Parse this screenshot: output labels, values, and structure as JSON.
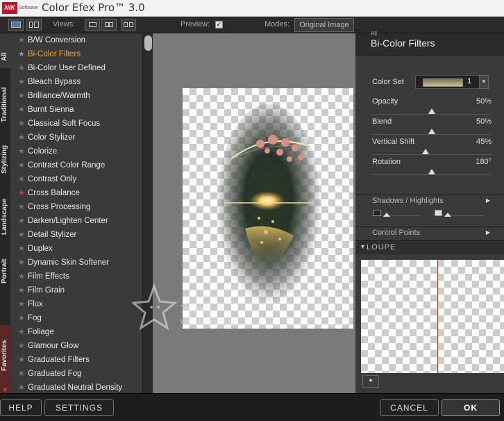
{
  "titlebar": {
    "title": "Color Efex Pro™ 3.0",
    "logo_text": "NIK",
    "logo_sub": "Software"
  },
  "toolbar": {
    "views_label": "Views:",
    "preview_label": "Preview:",
    "preview_checked": true,
    "modes_label": "Modes:",
    "original_image_label": "Original Image"
  },
  "vtabs": [
    "All",
    "Traditional",
    "Stylizing",
    "Landscape",
    "Portrait",
    "Favorites"
  ],
  "filters": [
    {
      "label": "B/W Conversion",
      "active": false,
      "fav": false
    },
    {
      "label": "Bi-Color Filters",
      "active": true,
      "fav": false
    },
    {
      "label": "Bi-Color User Defined",
      "active": false,
      "fav": false
    },
    {
      "label": "Bleach Bypass",
      "active": false,
      "fav": false
    },
    {
      "label": "Brilliance/Warmth",
      "active": false,
      "fav": false
    },
    {
      "label": "Burnt Sienna",
      "active": false,
      "fav": false
    },
    {
      "label": "Classical Soft Focus",
      "active": false,
      "fav": false
    },
    {
      "label": "Color Stylizer",
      "active": false,
      "fav": false
    },
    {
      "label": "Colorize",
      "active": false,
      "fav": false
    },
    {
      "label": "Contrast Color Range",
      "active": false,
      "fav": false
    },
    {
      "label": "Contrast Only",
      "active": false,
      "fav": false
    },
    {
      "label": "Cross Balance",
      "active": false,
      "fav": true
    },
    {
      "label": "Cross Processing",
      "active": false,
      "fav": false
    },
    {
      "label": "Darken/Lighten Center",
      "active": false,
      "fav": false
    },
    {
      "label": "Detail Stylizer",
      "active": false,
      "fav": false
    },
    {
      "label": "Duplex",
      "active": false,
      "fav": false
    },
    {
      "label": "Dynamic Skin Softener",
      "active": false,
      "fav": false
    },
    {
      "label": "Film Effects",
      "active": false,
      "fav": false
    },
    {
      "label": "Film Grain",
      "active": false,
      "fav": false
    },
    {
      "label": "Flux",
      "active": false,
      "fav": false
    },
    {
      "label": "Fog",
      "active": false,
      "fav": false
    },
    {
      "label": "Foliage",
      "active": false,
      "fav": false
    },
    {
      "label": "Glamour Glow",
      "active": false,
      "fav": false
    },
    {
      "label": "Graduated Filters",
      "active": false,
      "fav": false
    },
    {
      "label": "Graduated Fog",
      "active": false,
      "fav": false
    },
    {
      "label": "Graduated Neutral Density",
      "active": false,
      "fav": false
    }
  ],
  "panel": {
    "category": "All",
    "title": "Bi-Color Filters",
    "color_set_label": "Color Set",
    "color_set_value": "1",
    "params": [
      {
        "label": "Opacity",
        "value": "50%",
        "level": 0.5
      },
      {
        "label": "Blend",
        "value": "50%",
        "level": 0.5
      },
      {
        "label": "Vertical Shift",
        "value": "45%",
        "level": 0.45
      },
      {
        "label": "Rotation",
        "value": "180°",
        "level": 0.5
      }
    ],
    "shadows_label": "Shadows / Highlights",
    "control_points_label": "Control Points"
  },
  "loupe": {
    "label": "LOUPE"
  },
  "watermark": {
    "line1": "Tutorial",
    "line2": "www.tutorials.eu"
  },
  "bottom": {
    "help": "HELP",
    "settings": "SETTINGS",
    "cancel": "CANCEL",
    "ok": "OK"
  },
  "colors": {
    "accent": "#f0a020",
    "favorite": "#d23a3a",
    "loupe_line": "#d22222"
  }
}
